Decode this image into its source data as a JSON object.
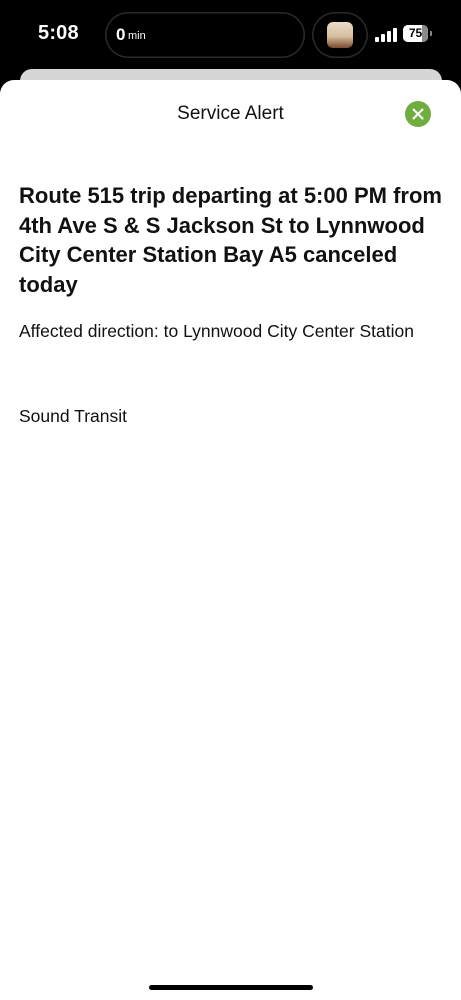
{
  "status_bar": {
    "time": "5:08",
    "live_activity": {
      "value": "0",
      "unit": "min"
    },
    "battery_level": "75",
    "battery_fraction": 0.75
  },
  "sheet": {
    "title": "Service Alert",
    "close_icon": "close-icon",
    "accent_color": "#6fae3e"
  },
  "alert": {
    "headline": "Route 515 trip departing at 5:00 PM from 4th Ave S & S Jackson St to Lynnwood City Center Station Bay A5 canceled today",
    "affected_direction": "Affected direction: to Lynnwood City Center Station",
    "agency": "Sound Transit"
  }
}
